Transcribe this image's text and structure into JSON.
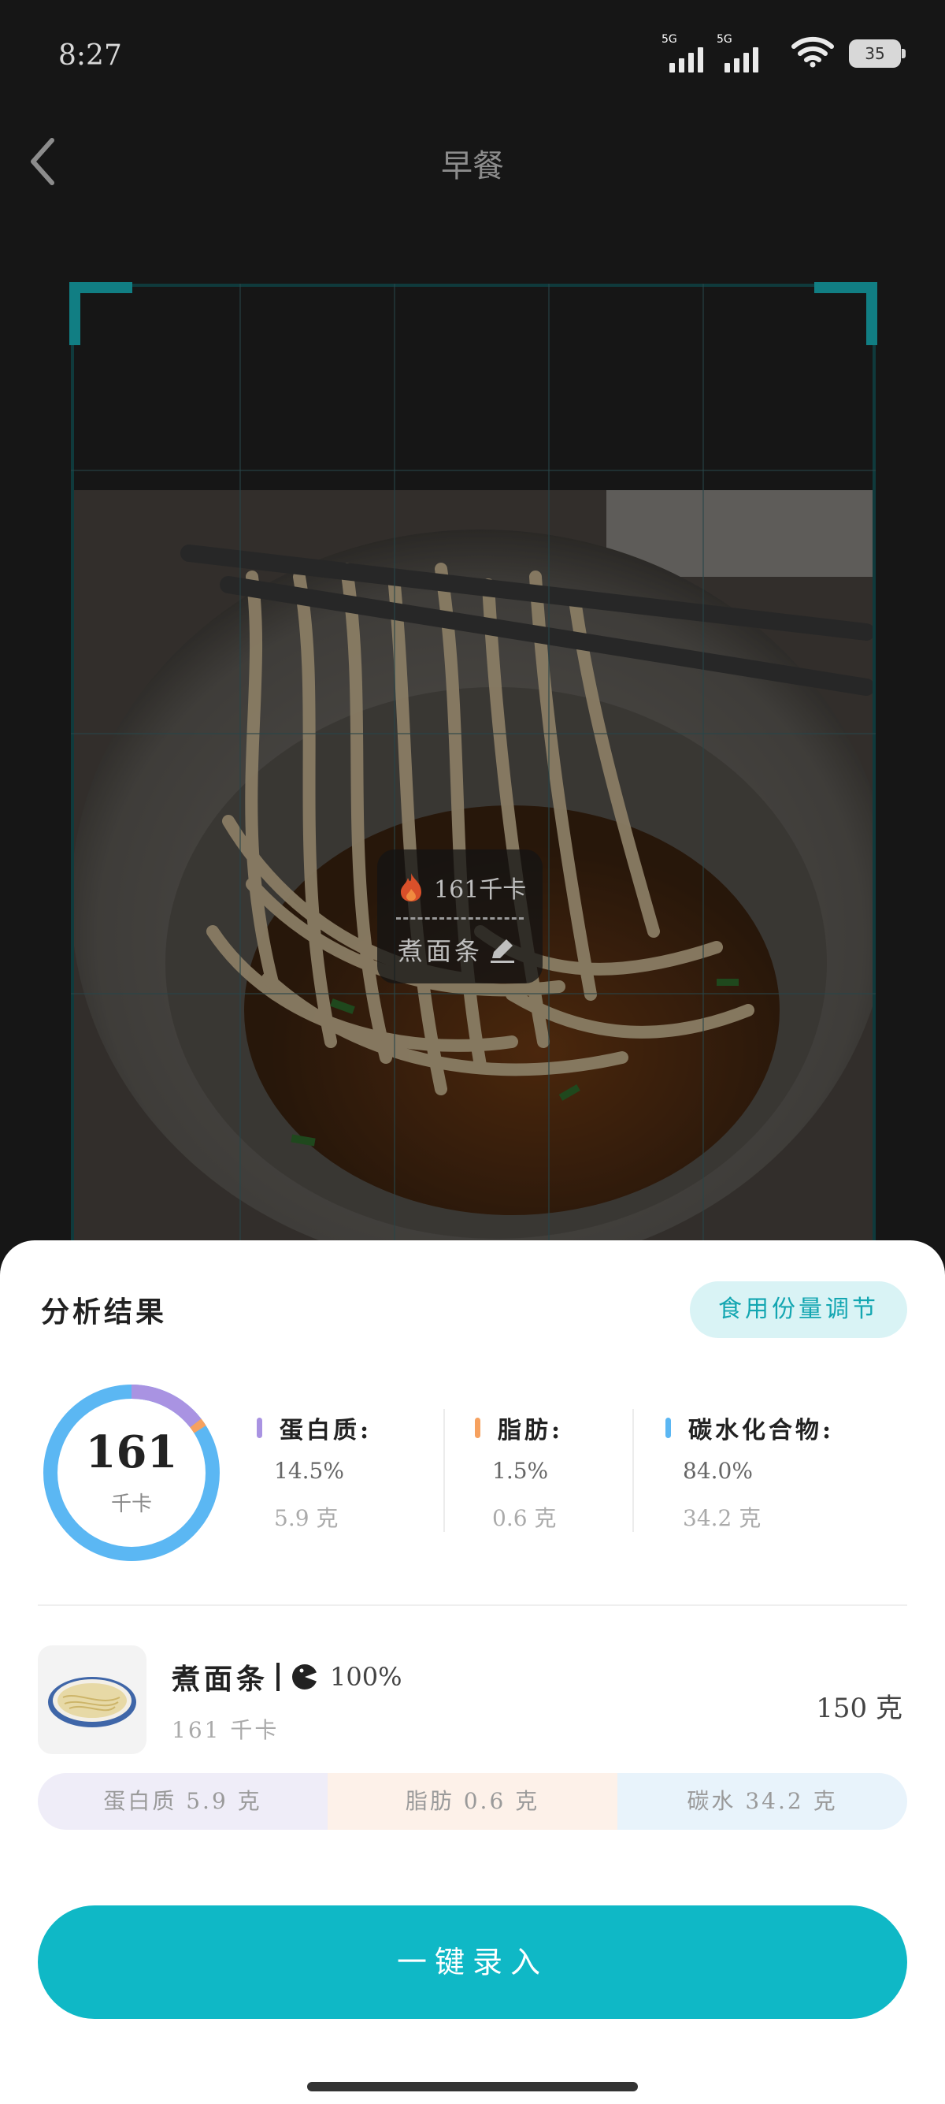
{
  "status_bar": {
    "time": "8:27",
    "network_1": "5G",
    "network_2": "5G",
    "battery": "35"
  },
  "nav": {
    "title": "早餐",
    "back_icon": "chevron-left-icon"
  },
  "food_tag": {
    "calories": "161千卡",
    "name": "煮面条",
    "fire_icon": "fire-icon",
    "edit_icon": "edit-icon"
  },
  "result": {
    "title": "分析结果",
    "portion_button": "食用份量调节",
    "total_kcal": "161",
    "kcal_unit": "千卡",
    "macros": [
      {
        "label": "蛋白质:",
        "percent": "14.5%",
        "grams": "5.9 克",
        "color": "#a993e2"
      },
      {
        "label": "脂肪:",
        "percent": "1.5%",
        "grams": "0.6 克",
        "color": "#f6a15f"
      },
      {
        "label": "碳水化合物:",
        "percent": "84.0%",
        "grams": "34.2 克",
        "color": "#5bb7f3"
      }
    ],
    "ring_fractions": {
      "protein": 0.145,
      "fat": 0.015,
      "carb": 0.84
    }
  },
  "food_item": {
    "name": "煮面条",
    "pie_icon": "pie-chart-icon",
    "percent": "100%",
    "kcal": "161 千卡",
    "weight": "150 克",
    "strip": {
      "protein": "蛋白质 5.9 克",
      "fat": "脂肪 0.6 克",
      "carb": "碳水 34.2 克"
    }
  },
  "submit_button": "一键录入",
  "colors": {
    "accent": "#0fb8c6",
    "accent_light": "#d9f3f5",
    "protein": "#a993e2",
    "fat": "#f6a15f",
    "carb": "#5bb7f3"
  }
}
